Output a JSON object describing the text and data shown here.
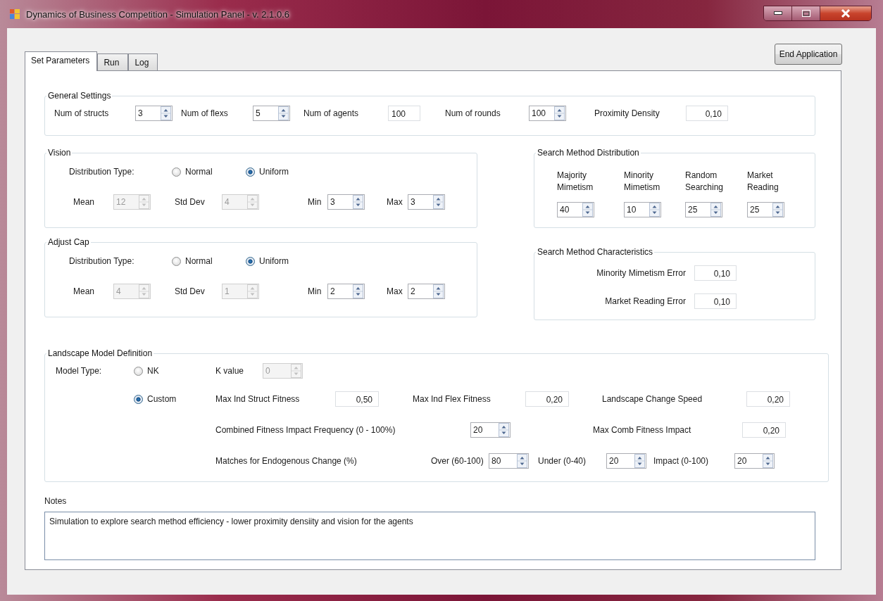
{
  "window": {
    "title": "Dynamics of Business Competition - Simulation Panel - v. 2.1.0.6"
  },
  "tabs": [
    {
      "label": "Set Parameters",
      "selected": true
    },
    {
      "label": "Run",
      "selected": false
    },
    {
      "label": "Log",
      "selected": false
    }
  ],
  "end_button": "End Application",
  "general_settings": {
    "title": "General Settings",
    "fields": [
      {
        "label": "Num of structs",
        "value": "3",
        "kind": "spin",
        "disabled": false
      },
      {
        "label": "Num of flexs",
        "value": "5",
        "kind": "spin",
        "disabled": false
      },
      {
        "label": "Num of agents",
        "value": "100",
        "kind": "text",
        "disabled": false
      },
      {
        "label": "Num of rounds",
        "value": "100",
        "kind": "spin",
        "disabled": false
      },
      {
        "label": "Proximity Density",
        "value": "0,10",
        "kind": "decimal",
        "disabled": false
      }
    ]
  },
  "vision": {
    "title": "Vision",
    "distribution_label": "Distribution Type:",
    "options": [
      {
        "label": "Normal",
        "selected": false
      },
      {
        "label": "Uniform",
        "selected": true
      }
    ],
    "fields": [
      {
        "label": "Mean",
        "value": "12",
        "kind": "spin",
        "disabled": true
      },
      {
        "label": "Std Dev",
        "value": "4",
        "kind": "spin",
        "disabled": true
      },
      {
        "label": "Min",
        "value": "3",
        "kind": "spin",
        "disabled": false
      },
      {
        "label": "Max",
        "value": "3",
        "kind": "spin",
        "disabled": false
      }
    ]
  },
  "adjust_cap": {
    "title": "Adjust Cap",
    "distribution_label": "Distribution Type:",
    "options": [
      {
        "label": "Normal",
        "selected": false
      },
      {
        "label": "Uniform",
        "selected": true
      }
    ],
    "fields": [
      {
        "label": "Mean",
        "value": "4",
        "kind": "spin",
        "disabled": true
      },
      {
        "label": "Std Dev",
        "value": "1",
        "kind": "spin",
        "disabled": true
      },
      {
        "label": "Min",
        "value": "2",
        "kind": "spin",
        "disabled": false
      },
      {
        "label": "Max",
        "value": "2",
        "kind": "spin",
        "disabled": false
      }
    ]
  },
  "search_method_distribution": {
    "title": "Search Method Distribution",
    "fields": [
      {
        "label": "Majority Mimetism",
        "value": "40",
        "kind": "spin",
        "disabled": false
      },
      {
        "label": "Minority Mimetism",
        "value": "10",
        "kind": "spin",
        "disabled": false
      },
      {
        "label": "Random Searching",
        "value": "25",
        "kind": "spin",
        "disabled": false
      },
      {
        "label": "Market Reading",
        "value": "25",
        "kind": "spin",
        "disabled": false
      }
    ]
  },
  "search_method_characteristics": {
    "title": "Search Method Characteristics",
    "fields": [
      {
        "label": "Minority Mimetism Error",
        "value": "0,10",
        "kind": "decimal",
        "disabled": false
      },
      {
        "label": "Market Reading Error",
        "value": "0,10",
        "kind": "decimal",
        "disabled": false
      }
    ]
  },
  "landscape": {
    "title": "Landscape Model Definition",
    "model_type_label": "Model Type:",
    "options": [
      {
        "label": "NK",
        "selected": false
      },
      {
        "label": "Custom",
        "selected": true
      }
    ],
    "k_value": {
      "label": "K value",
      "value": "0",
      "kind": "spin",
      "disabled": true
    },
    "fitness_fields": [
      {
        "label": "Max Ind Struct Fitness",
        "value": "0,50",
        "kind": "decimal",
        "disabled": false
      },
      {
        "label": "Max Ind Flex Fitness",
        "value": "0,20",
        "kind": "decimal",
        "disabled": false
      },
      {
        "label": "Landscape Change Speed",
        "value": "0,20",
        "kind": "decimal",
        "disabled": false
      }
    ],
    "impact_frequency": {
      "label": "Combined Fitness Impact Frequency (0 - 100%)",
      "value": "20",
      "kind": "spin",
      "disabled": false
    },
    "max_comb_impact": {
      "label": "Max Comb Fitness Impact",
      "value": "0,20",
      "kind": "decimal",
      "disabled": false
    },
    "endogenous_change": {
      "label": "Matches for Endogenous Change (%)",
      "fields": [
        {
          "label": "Over (60-100)",
          "value": "80",
          "kind": "spin",
          "disabled": false
        },
        {
          "label": "Under (0-40)",
          "value": "20",
          "kind": "spin",
          "disabled": false
        },
        {
          "label": "Impact (0-100)",
          "value": "20",
          "kind": "spin",
          "disabled": false
        }
      ]
    }
  },
  "notes": {
    "label": "Notes",
    "value": "Simulation to explore search method efficiency - lower proximity densiity and vision for the agents"
  }
}
